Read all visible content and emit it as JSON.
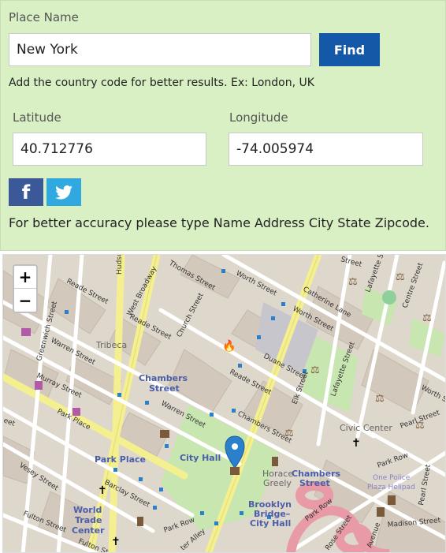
{
  "form": {
    "place_label": "Place Name",
    "place_value": "New York",
    "find_button": "Find",
    "hint": "Add the country code for better results. Ex: London, UK",
    "lat_label": "Latitude",
    "lat_value": "40.712776",
    "lng_label": "Longitude",
    "lng_value": "-74.005974",
    "accuracy_note": "For better accuracy please type Name Address City State Zipcode."
  },
  "share": {
    "facebook_glyph": "f",
    "twitter_icon": "twitter-bird-icon"
  },
  "map": {
    "zoom_in": "+",
    "zoom_out": "−",
    "places": {
      "tribeca": "Tribeca",
      "chambers_street_1": "Chambers",
      "chambers_street_2": "Street",
      "park_place": "Park Place",
      "city_hall": "City Hall",
      "civic_center": "Civic Center",
      "horace_greely_1": "Horace",
      "horace_greely_2": "Greely",
      "chambers_street_b1": "Chambers",
      "chambers_street_b2": "Street",
      "brooklyn_bridge_1": "Brooklyn",
      "brooklyn_bridge_2": "Bridge–",
      "brooklyn_bridge_3": "City Hall",
      "world_trade_1": "World",
      "world_trade_2": "Trade",
      "world_trade_3": "Center",
      "one_police_1": "One Police",
      "one_police_2": "Plaza Helipad"
    },
    "streets": {
      "hudson": "Hudson",
      "thomas": "Thomas Street",
      "west_broadway": "West Broadway",
      "worth": "Worth Street",
      "catherine": "Catherine Lane",
      "lafayette": "Lafayette Street",
      "centre": "Centre Street",
      "reade_1": "Reade Street",
      "church": "Church Street",
      "reade_2": "Reade Street",
      "greenwich": "Greenwich Street",
      "warren_1": "Warren Street",
      "duane": "Duane Street",
      "worth_2": "Worth Street",
      "elk": "Elk Street",
      "lafayette_2": "Lafayette Street",
      "reade_3": "Reade Street",
      "murray": "Murray Street",
      "warren_2": "Warren Street",
      "chambers": "Chambers Street",
      "worth_3": "Worth St",
      "park_place": "Park Place",
      "pearl": "Pearl Street",
      "park_row_1": "Park Row",
      "park_row_2": "Park Row",
      "park_row_3": "Park Row",
      "vesey": "Vesey Street",
      "barclay": "Barclay Street",
      "fulton": "Fulton Street",
      "fulton_2": "Fulton St",
      "madison": "Madison Street",
      "rose": "Rose Street",
      "pearl_2": "Pearl Street",
      "street_top": "Street",
      "eet": "eet",
      "alley": "ter Alley",
      "avenue": "Avenue"
    },
    "colors": {
      "park": "#c8e6b0",
      "road_major": "#f7f4a0",
      "road_minor": "#ffffff",
      "building": "#d6cdc2",
      "marker": "#2a80cb"
    }
  }
}
